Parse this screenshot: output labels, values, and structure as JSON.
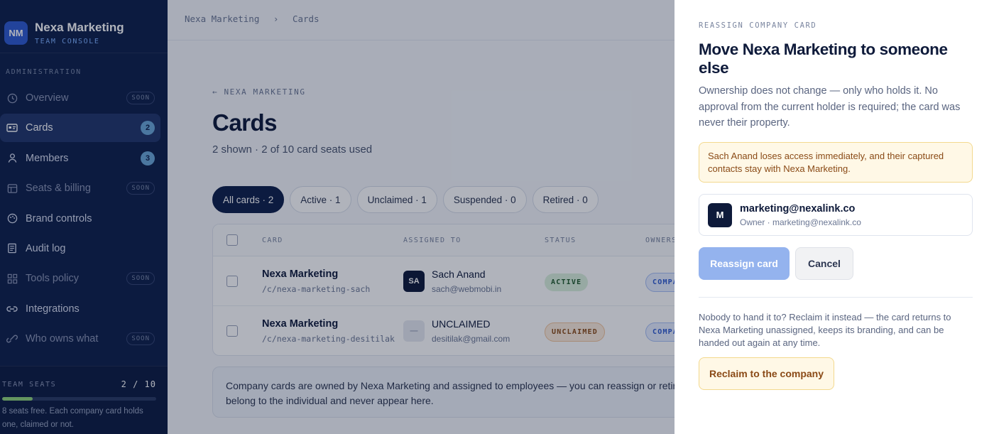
{
  "sidebar": {
    "logo_initials": "NM",
    "brand_name": "Nexa Marketing",
    "brand_sub": "TEAM CONSOLE",
    "section_title": "ADMINISTRATION",
    "items": [
      {
        "label": "Overview",
        "badge": "SOON",
        "icon": "clock-icon"
      },
      {
        "label": "Cards",
        "count": "2",
        "icon": "id-card-icon"
      },
      {
        "label": "Members",
        "count": "3",
        "icon": "user-icon"
      },
      {
        "label": "Seats & billing",
        "badge": "SOON",
        "icon": "billing-icon"
      },
      {
        "label": "Brand controls",
        "icon": "palette-icon"
      },
      {
        "label": "Audit log",
        "icon": "log-icon"
      },
      {
        "label": "Tools policy",
        "badge": "SOON",
        "icon": "grid-icon"
      },
      {
        "label": "Integrations",
        "icon": "link-icon"
      },
      {
        "label": "Who owns what",
        "badge": "SOON",
        "icon": "link-icon"
      }
    ],
    "seats": {
      "title": "TEAM SEATS",
      "count": "2 / 10",
      "used_fraction": 0.2,
      "note": "8 seats free. Each company card holds one, claimed or not."
    }
  },
  "main": {
    "breadcrumb": [
      "Nexa Marketing",
      "Cards"
    ],
    "breadcrumb_sep": "›",
    "back_link": "← NEXA MARKETING",
    "title": "Cards",
    "subtitle": "2 shown · 2 of 10 card seats used",
    "tabs": [
      {
        "label": "All cards · 2"
      },
      {
        "label": "Active · 1"
      },
      {
        "label": "Unclaimed · 1"
      },
      {
        "label": "Suspended · 0"
      },
      {
        "label": "Retired · 0"
      }
    ],
    "table": {
      "headers": [
        "CARD",
        "ASSIGNED TO",
        "STATUS",
        "OWNERS"
      ],
      "rows": [
        {
          "card": "Nexa Marketing",
          "path": "/c/nexa-marketing-sach",
          "avatar": "SA",
          "name": "Sach Anand",
          "email": "sach@webmobi.in",
          "status": "ACTIVE",
          "owner": "COMPA"
        },
        {
          "card": "Nexa Marketing",
          "path": "/c/nexa-marketing-desitilak",
          "avatar": "—",
          "name": "UNCLAIMED",
          "email": "desitilak@gmail.com",
          "status": "UNCLAIMED",
          "owner": "COMPA"
        }
      ]
    },
    "info": "Company cards are owned by Nexa Marketing and assigned to employees — you can reassign or retire a belong to the individual and never appear here."
  },
  "drawer": {
    "eyebrow": "REASSIGN COMPANY CARD",
    "title": "Move Nexa Marketing to someone else",
    "description": "Ownership does not change — only who holds it. No approval from the current holder is required; the card was never their property.",
    "warning": "Sach Anand loses access immediately, and their captured contacts stay with Nexa Marketing.",
    "target": {
      "avatar": "M",
      "email": "marketing@nexalink.co",
      "sub": "Owner · marketing@nexalink.co"
    },
    "reassign_label": "Reassign card",
    "cancel_label": "Cancel",
    "reclaim_text": "Nobody to hand it to? Reclaim it instead — the card returns to Nexa Marketing unassigned, keeps its branding, and can be handed out again at any time.",
    "reclaim_label": "Reclaim to the company"
  }
}
